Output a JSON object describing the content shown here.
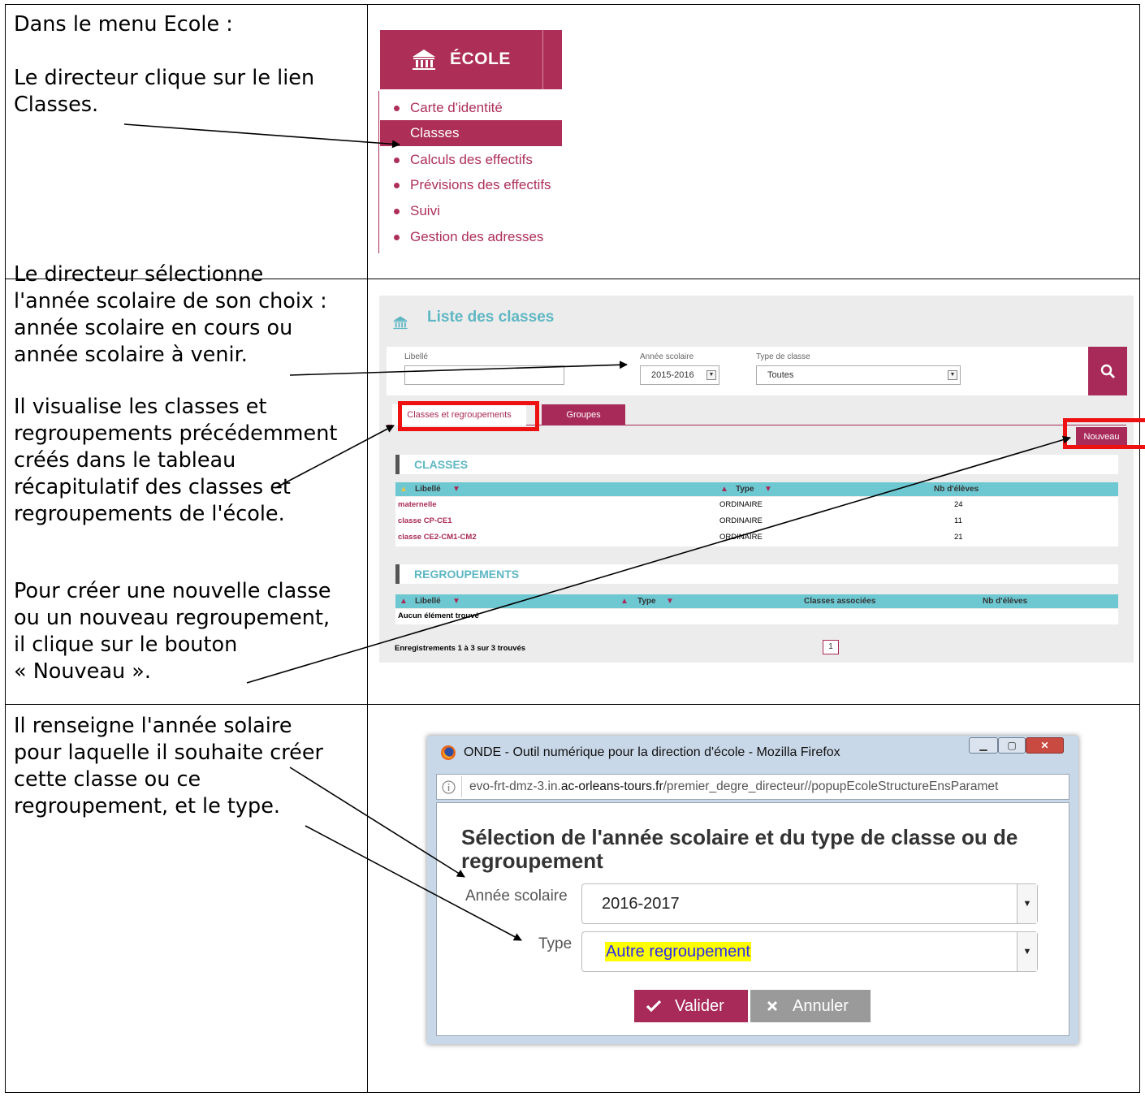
{
  "rows": [
    {
      "paragraphs": [
        "Dans le menu Ecole :",
        "Le directeur clique sur le lien\nClasses."
      ]
    },
    {
      "paragraphs": [
        "Le directeur sélectionne\nl'année scolaire de son choix :\nannée scolaire en cours ou\nannée scolaire à venir.",
        "Il visualise les classes et\nregroupements précédemment\ncréés dans le tableau\nrécapitulatif des classes et\nregroupements de l'école.",
        "Pour créer une nouvelle classe\nou un nouveau regroupement,\nil clique sur le bouton\n« Nouveau »."
      ]
    },
    {
      "paragraphs": [
        "Il renseigne l'année solaire\npour laquelle il souhaite créer\ncette classe ou ce\nregroupement, et le type."
      ]
    }
  ],
  "ecole_menu": {
    "title": "ÉCOLE",
    "items": [
      {
        "label": "Carte d'identité"
      },
      {
        "label": "Classes"
      },
      {
        "label": "Calculs des effectifs"
      },
      {
        "label": "Prévisions des effectifs"
      },
      {
        "label": "Suivi"
      },
      {
        "label": "Gestion des adresses"
      }
    ],
    "active_item": "Classes"
  },
  "liste_classes": {
    "title": "Liste des classes",
    "filters": {
      "libelle_label": "Libellé",
      "libelle_value": "",
      "annee_label": "Année scolaire",
      "annee_value": "2015-2016",
      "type_label": "Type de classe",
      "type_value": "Toutes"
    },
    "tabs": [
      "Classes et regroupements",
      "Groupes"
    ],
    "nouveau_label": "Nouveau",
    "classes": {
      "title": "CLASSES",
      "headers": [
        "Libellé",
        "Type",
        "Nb d'élèves"
      ],
      "rows": [
        {
          "libelle": "maternelle",
          "type": "ORDINAIRE",
          "nb": "24"
        },
        {
          "libelle": "classe CP-CE1",
          "type": "ORDINAIRE",
          "nb": "11"
        },
        {
          "libelle": "classe CE2-CM1-CM2",
          "type": "ORDINAIRE",
          "nb": "21"
        }
      ]
    },
    "regroupements": {
      "title": "REGROUPEMENTS",
      "headers": [
        "Libellé",
        "Type",
        "Classes associées",
        "Nb d'élèves"
      ],
      "empty": "Aucun élément trouvé"
    },
    "records": "Enregistrements 1 à 3 sur 3 trouvés",
    "page": "1"
  },
  "popup": {
    "window_title": "ONDE - Outil numérique pour la direction d'école - Mozilla Firefox",
    "url_prefix": "evo-frt-dmz-3.in.",
    "url_domain": "ac-orleans-tours.fr",
    "url_path": "/premier_degre_directeur//popupEcoleStructureEnsParamet",
    "heading": "Sélection de l'année scolaire et du type de classe ou de regroupement",
    "annee_label": "Année scolaire",
    "annee_value": "2016-2017",
    "type_label": "Type",
    "type_value": "Autre regroupement",
    "valider": "Valider",
    "annuler": "Annuler"
  },
  "colors": {
    "brand": "#ad2f58",
    "teal": "#5eb7c3",
    "highlight": "#ee1111"
  }
}
